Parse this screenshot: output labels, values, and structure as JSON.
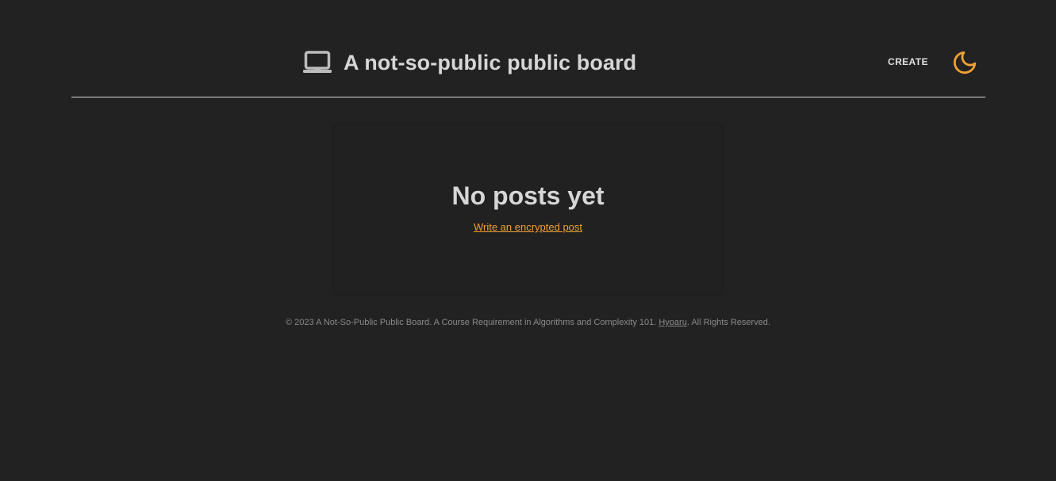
{
  "header": {
    "title": "A not-so-public public board",
    "logo_icon": "laptop-icon",
    "nav": {
      "create_label": "CREATE"
    },
    "theme_toggle_icon": "moon-icon"
  },
  "main": {
    "empty_state": {
      "title": "No posts yet",
      "link_text": "Write an encrypted post"
    }
  },
  "footer": {
    "text_before": "© 2023 A Not-So-Public Public Board. A Course Requirement in Algorithms and Complexity 101. ",
    "author_link": "Hyoaru",
    "text_after": ". All Rights Reserved."
  },
  "colors": {
    "background": "#222222",
    "accent": "#f0a033",
    "text": "#d6d6d6",
    "muted": "#8a8a8a"
  }
}
